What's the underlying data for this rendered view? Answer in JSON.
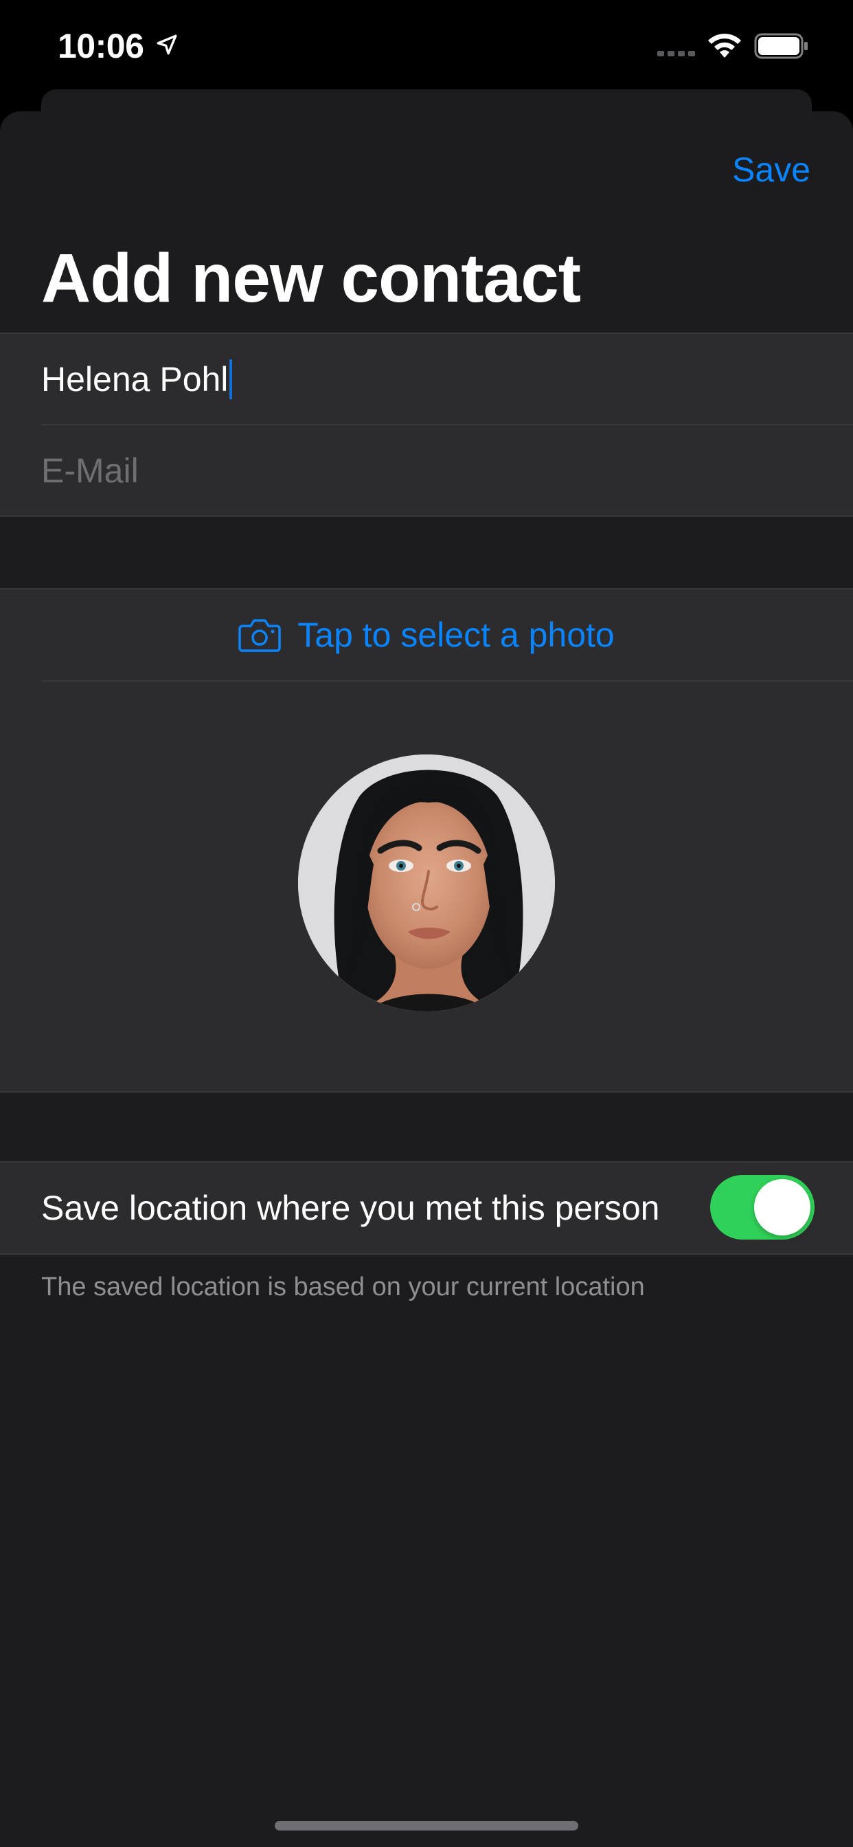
{
  "status_bar": {
    "time": "10:06",
    "location_icon": "location-arrow-icon",
    "signal_icon": "cellular-signal-icon",
    "wifi_icon": "wifi-icon",
    "battery_icon": "battery-icon"
  },
  "nav": {
    "save_label": "Save",
    "title": "Add new contact"
  },
  "form": {
    "name_value": "Helena Pohl",
    "email_placeholder": "E-Mail",
    "email_value": ""
  },
  "photo": {
    "select_label": "Tap to select a photo",
    "select_icon": "camera-icon"
  },
  "location": {
    "toggle_label": "Save location where you met this person",
    "toggle_on": true,
    "footer_note": "The saved location is based on your current location"
  },
  "colors": {
    "accent": "#0a84ff",
    "toggle_on": "#30d158",
    "background": "#1c1c1e",
    "cell_background": "#2c2c2e",
    "secondary_text": "#8e8e93"
  }
}
